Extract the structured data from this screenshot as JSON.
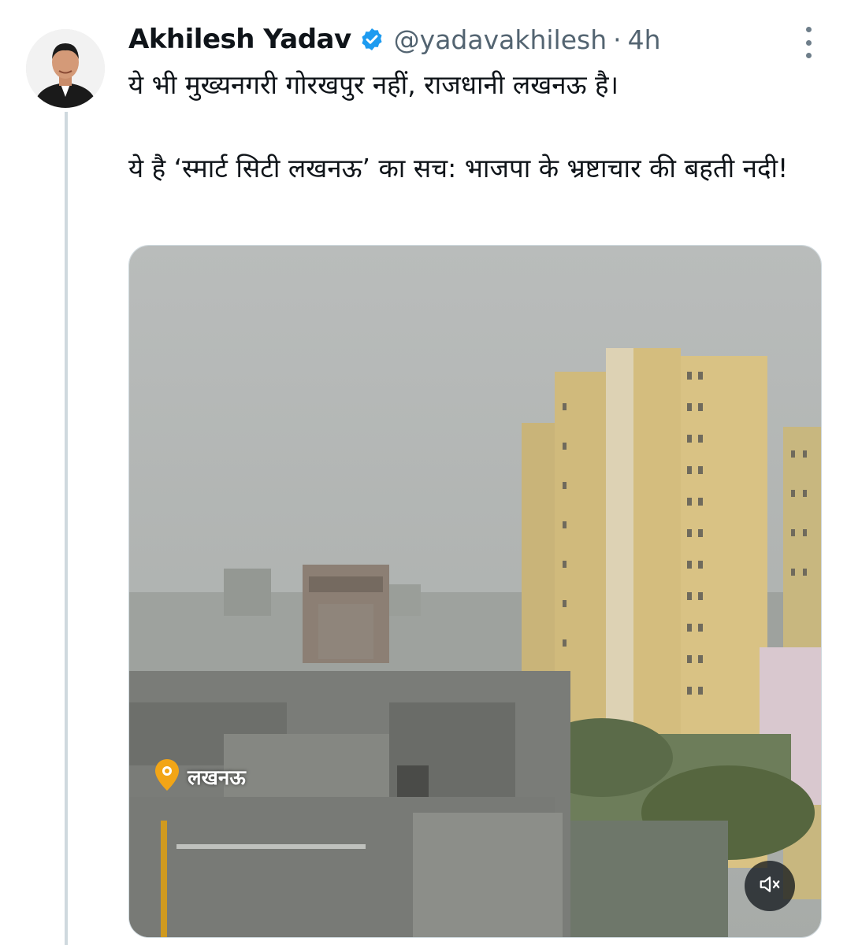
{
  "tweet": {
    "author_name": "Akhilesh Yadav",
    "handle": "@yadavakhilesh",
    "separator": "·",
    "time": "4h",
    "text_line_1": "ये भी मुख्यनगरी गोरखपुर नहीं, राजधानी लखनऊ है।",
    "text_line_2": "ये है ‘स्मार्ट सिटी लखनऊ’ का सच: भाजपा के भ्रष्टाचार की बहती नदी!"
  },
  "media": {
    "location_label": "लखनऊ",
    "mute_icon": "speaker-muted-icon"
  },
  "colors": {
    "text_primary": "#0f1419",
    "text_secondary": "#536471",
    "verified_blue": "#1d9bf0",
    "thread_line": "#cfd9de"
  }
}
